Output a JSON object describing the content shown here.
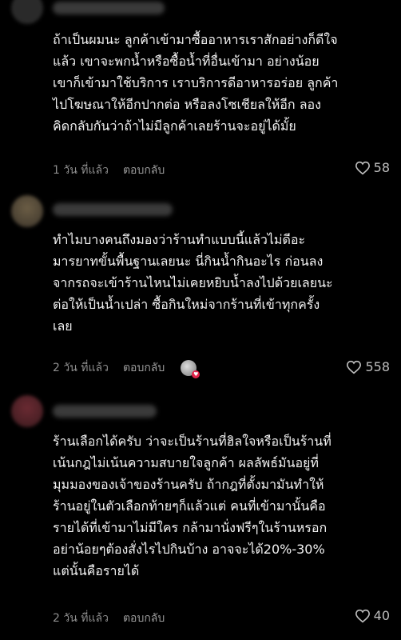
{
  "comments": [
    {
      "text": "ถ้าเป็นผมนะ ลูกค้าเข้ามาซื้ออาหารเราสักอย่างก็ดีใจ\nแล้ว เขาจะพกน้ำหรือซื้อน้ำที่อื่นเข้ามา อย่างน้อย\nเขาก็เข้ามาใช้บริการ เราบริการดีอาหารอร่อย ลูกค้า\nไปโฆษณาให้อีกปากต่อ หรือลงโซเชียลให้อีก ลอง\nคิดกลับกันว่าถ้าไม่มีลูกค้าเลยร้านจะอยู่ได้มั้ย",
      "time": "1 วัน ที่แล้ว",
      "reply": "ตอบกลับ",
      "likes": "58"
    },
    {
      "text": "ทำไมบางคนถึงมองว่าร้านทำแบบนี้แล้วไม่ดีอะ\nมารยาทขั้นพื้นฐานเลยนะ นี่กินน้ำกินอะไร ก่อนลง\nจากรถจะเข้าร้านไหนไม่เคยหยิบน้ำลงไปด้วยเลยนะ\nต่อให้เป็นน้ำเปล่า ซื้อกินใหม่จากร้านที่เข้าทุกครั้ง\nเลย",
      "time": "2 วัน ที่แล้ว",
      "reply": "ตอบกลับ",
      "likes": "558"
    },
    {
      "text": "ร้านเลือกได้ครับ ว่าจะเป็นร้านที่ฮิลใจหรือเป็นร้านที่\nเน้นกฎไม่เน้นความสบายใจลูกค้า ผลลัพธ์มันอยู่ที่\nมุมมองของเจ้าของร้านครับ ถ้ากฎที่ตั้งมามันทำให้\nร้านอยู่ในตัวเลือกท้ายๆก็แล้วแต่ คนที่เข้ามานั้นคือ\nรายได้ที่เข้ามาไม่มีใคร กล้ามานั่งฟรีๆในร้านหรอก\nอย่าน้อยๆต้องสั่งไรไปกินบ้าง อาจจะได้20%-30%\nแต่นั้นคือรายได้",
      "time": "2 วัน ที่แล้ว",
      "reply": "ตอบกลับ",
      "likes": "40"
    }
  ],
  "icons": {
    "like": "heart-outline-icon",
    "creator_like": "heart-badge-icon"
  },
  "colors": {
    "background": "#000000",
    "text": "#f2f2f2",
    "meta": "#8e8e8e",
    "heart_badge": "#e0244a"
  }
}
